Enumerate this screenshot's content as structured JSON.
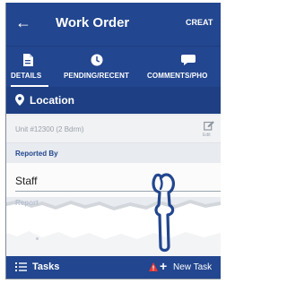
{
  "header": {
    "back_symbol": "←",
    "title": "Work Order",
    "action": "CREAT"
  },
  "tabs": [
    {
      "label": "DETAILS",
      "icon": "document-icon",
      "active": true
    },
    {
      "label": "PENDING/RECENT",
      "icon": "clock-icon",
      "active": false
    },
    {
      "label": "COMMENTS/PHO",
      "icon": "chat-icon",
      "active": false
    }
  ],
  "location": {
    "title": "Location",
    "unit": "Unit #12300 (2 Bdrm)",
    "edit_label": "Edit"
  },
  "reported_by": {
    "label": "Reported By",
    "value": "Staff"
  },
  "ghost_label": "Report",
  "bottom": {
    "tasks_label": "Tasks",
    "new_task_label": "New Task",
    "plus_symbol": "+"
  },
  "colors": {
    "primary": "#22468f",
    "section": "#1e3f83",
    "warning": "#e53935",
    "hand": "#22468f"
  }
}
